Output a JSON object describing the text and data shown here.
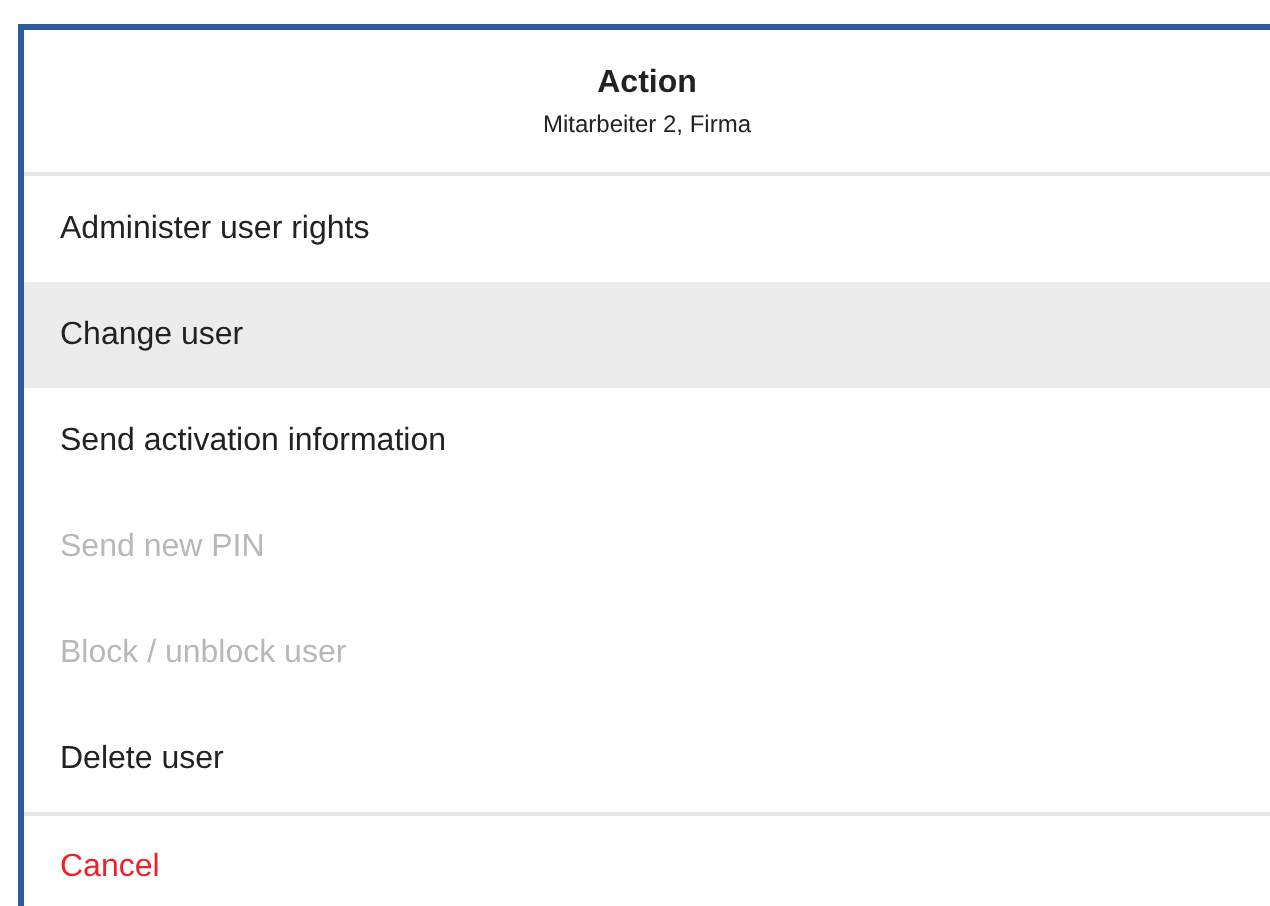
{
  "header": {
    "title": "Action",
    "subtitle": "Mitarbeiter 2, Firma"
  },
  "actions": [
    {
      "label": "Administer user rights",
      "selected": false,
      "disabled": false
    },
    {
      "label": "Change user",
      "selected": true,
      "disabled": false
    },
    {
      "label": "Send activation information",
      "selected": false,
      "disabled": false
    },
    {
      "label": "Send new PIN",
      "selected": false,
      "disabled": true
    },
    {
      "label": "Block / unblock user",
      "selected": false,
      "disabled": true
    },
    {
      "label": "Delete user",
      "selected": false,
      "disabled": false
    }
  ],
  "cancel": {
    "label": "Cancel"
  }
}
